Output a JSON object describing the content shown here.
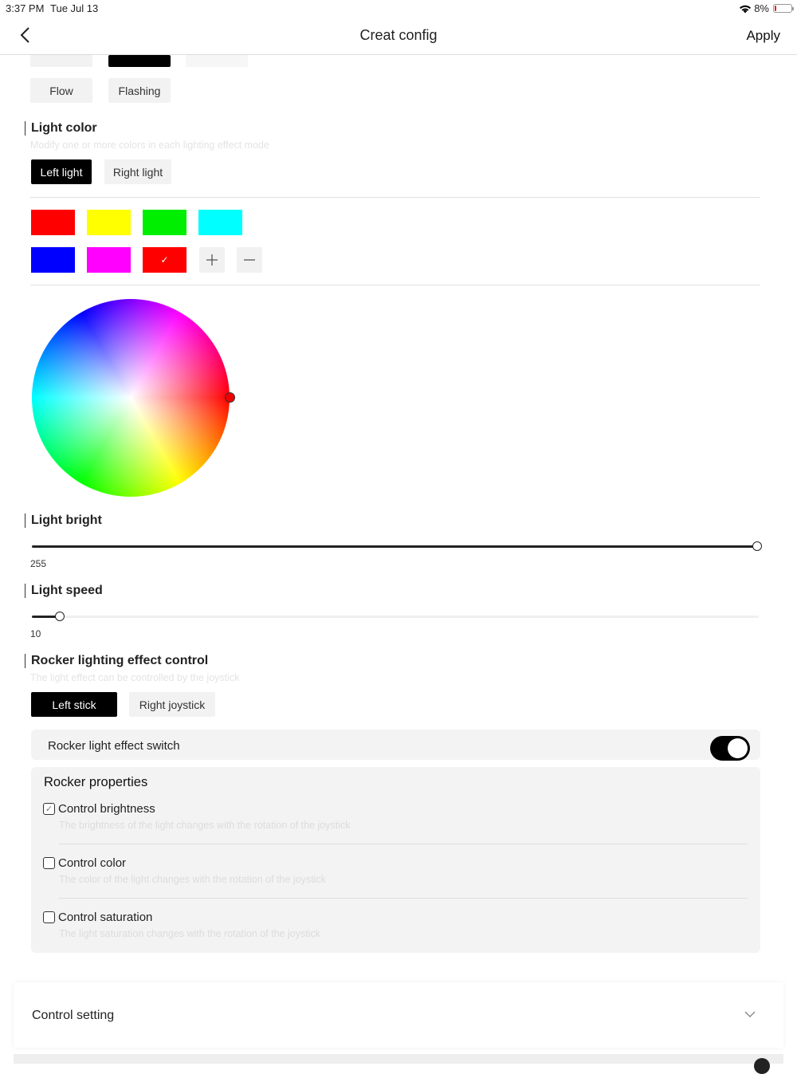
{
  "status_bar": {
    "time": "3:37 PM",
    "date": "Tue Jul 13",
    "battery": "8%"
  },
  "nav": {
    "title": "Creat config",
    "apply_label": "Apply"
  },
  "mode_chips": {
    "flow": "Flow",
    "flashing": "Flashing"
  },
  "light_color": {
    "title": "Light color",
    "hint": "Modify one or more colors in each lighting effect mode",
    "tabs": [
      "Left light",
      "Right light"
    ],
    "active_tab": "Left light",
    "swatches": [
      "#ff0000",
      "#ffff00",
      "#00ee00",
      "#00ffff",
      "#0000ff",
      "#ff00ff",
      "#ff0000"
    ],
    "selected_swatch_mark": "✓",
    "add_icon": "plus-icon",
    "remove_icon": "minus-icon",
    "picker_color": "#ff0000"
  },
  "light_bright": {
    "title": "Light bright",
    "value": "255",
    "max": 255
  },
  "light_speed": {
    "title": "Light speed",
    "value": "10",
    "fraction": 0.04
  },
  "rocker": {
    "title": "Rocker lighting effect control",
    "hint": "The light effect can be controlled by the joystick",
    "tabs": [
      "Left stick",
      "Right joystick"
    ],
    "active_tab": "Left stick",
    "switch_label": "Rocker light effect switch",
    "switch_on": true,
    "properties_title": "Rocker properties",
    "properties": [
      {
        "label": "Control brightness",
        "desc": "The brightness of the light changes with the rotation of the joystick",
        "checked": true
      },
      {
        "label": "Control color",
        "desc": "The color of the light changes with the rotation of the joystick",
        "checked": false
      },
      {
        "label": "Control saturation",
        "desc": "The light saturation changes with the rotation of the joystick",
        "checked": false
      }
    ]
  },
  "control_setting": {
    "label": "Control setting"
  }
}
